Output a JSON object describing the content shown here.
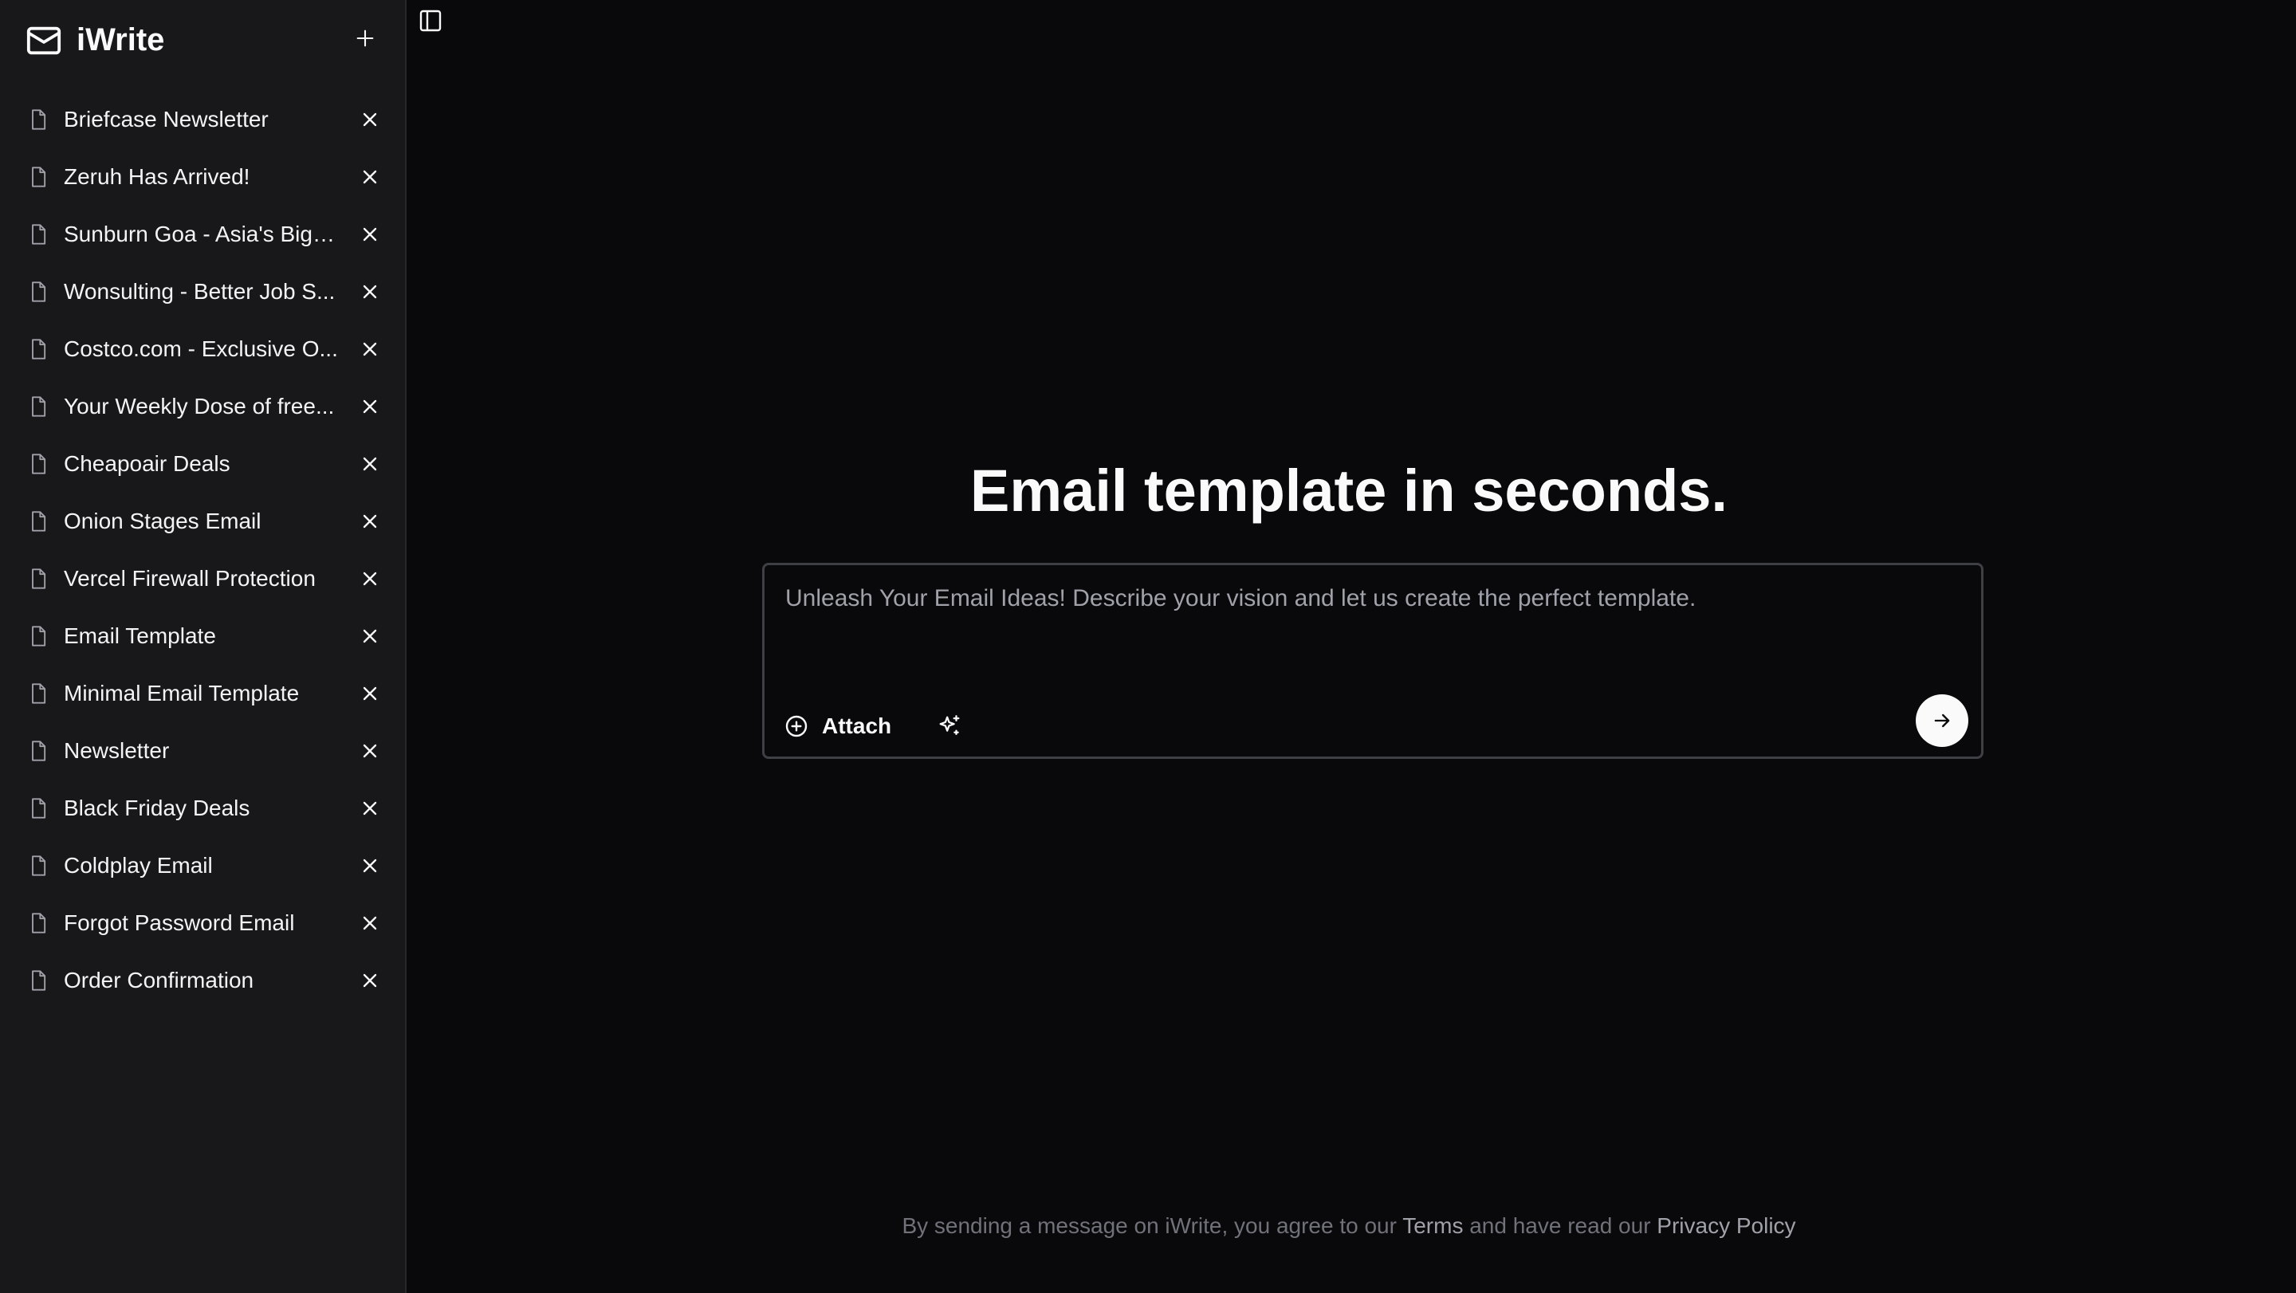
{
  "app": {
    "name": "iWrite",
    "new_label": "+"
  },
  "sidebar": {
    "items": [
      {
        "label": "Briefcase Newsletter"
      },
      {
        "label": "Zeruh Has Arrived!"
      },
      {
        "label": "Sunburn Goa - Asia's Bigg..."
      },
      {
        "label": "Wonsulting - Better Job S..."
      },
      {
        "label": "Costco.com - Exclusive O..."
      },
      {
        "label": "Your Weekly Dose of free..."
      },
      {
        "label": "Cheapoair Deals"
      },
      {
        "label": "Onion Stages Email"
      },
      {
        "label": "Vercel Firewall Protection"
      },
      {
        "label": "Email Template"
      },
      {
        "label": "Minimal Email Template"
      },
      {
        "label": "Newsletter"
      },
      {
        "label": "Black Friday Deals"
      },
      {
        "label": "Coldplay Email"
      },
      {
        "label": "Forgot Password Email"
      },
      {
        "label": "Order Confirmation"
      }
    ]
  },
  "main": {
    "title": "Email template in seconds.",
    "composer": {
      "placeholder": "Unleash Your Email Ideas! Describe your vision and let us create the perfect template.",
      "attach_label": "Attach"
    },
    "footer": {
      "prefix": "By sending a message on iWrite, you agree to our ",
      "terms": "Terms",
      "middle": " and have read our ",
      "privacy": "Privacy Policy"
    }
  },
  "icons": {
    "brand": "mail-icon",
    "new": "plus-icon",
    "doc": "file-icon",
    "close": "close-icon",
    "toggle": "sidebar-toggle-icon",
    "attach": "plus-circle-icon",
    "magic": "sparkles-icon",
    "send": "arrow-right-icon"
  },
  "colors": {
    "background": "#09090b",
    "sidebar": "#18181b",
    "text": "#fafafa",
    "muted": "#71717a",
    "border": "#3f3f46"
  }
}
